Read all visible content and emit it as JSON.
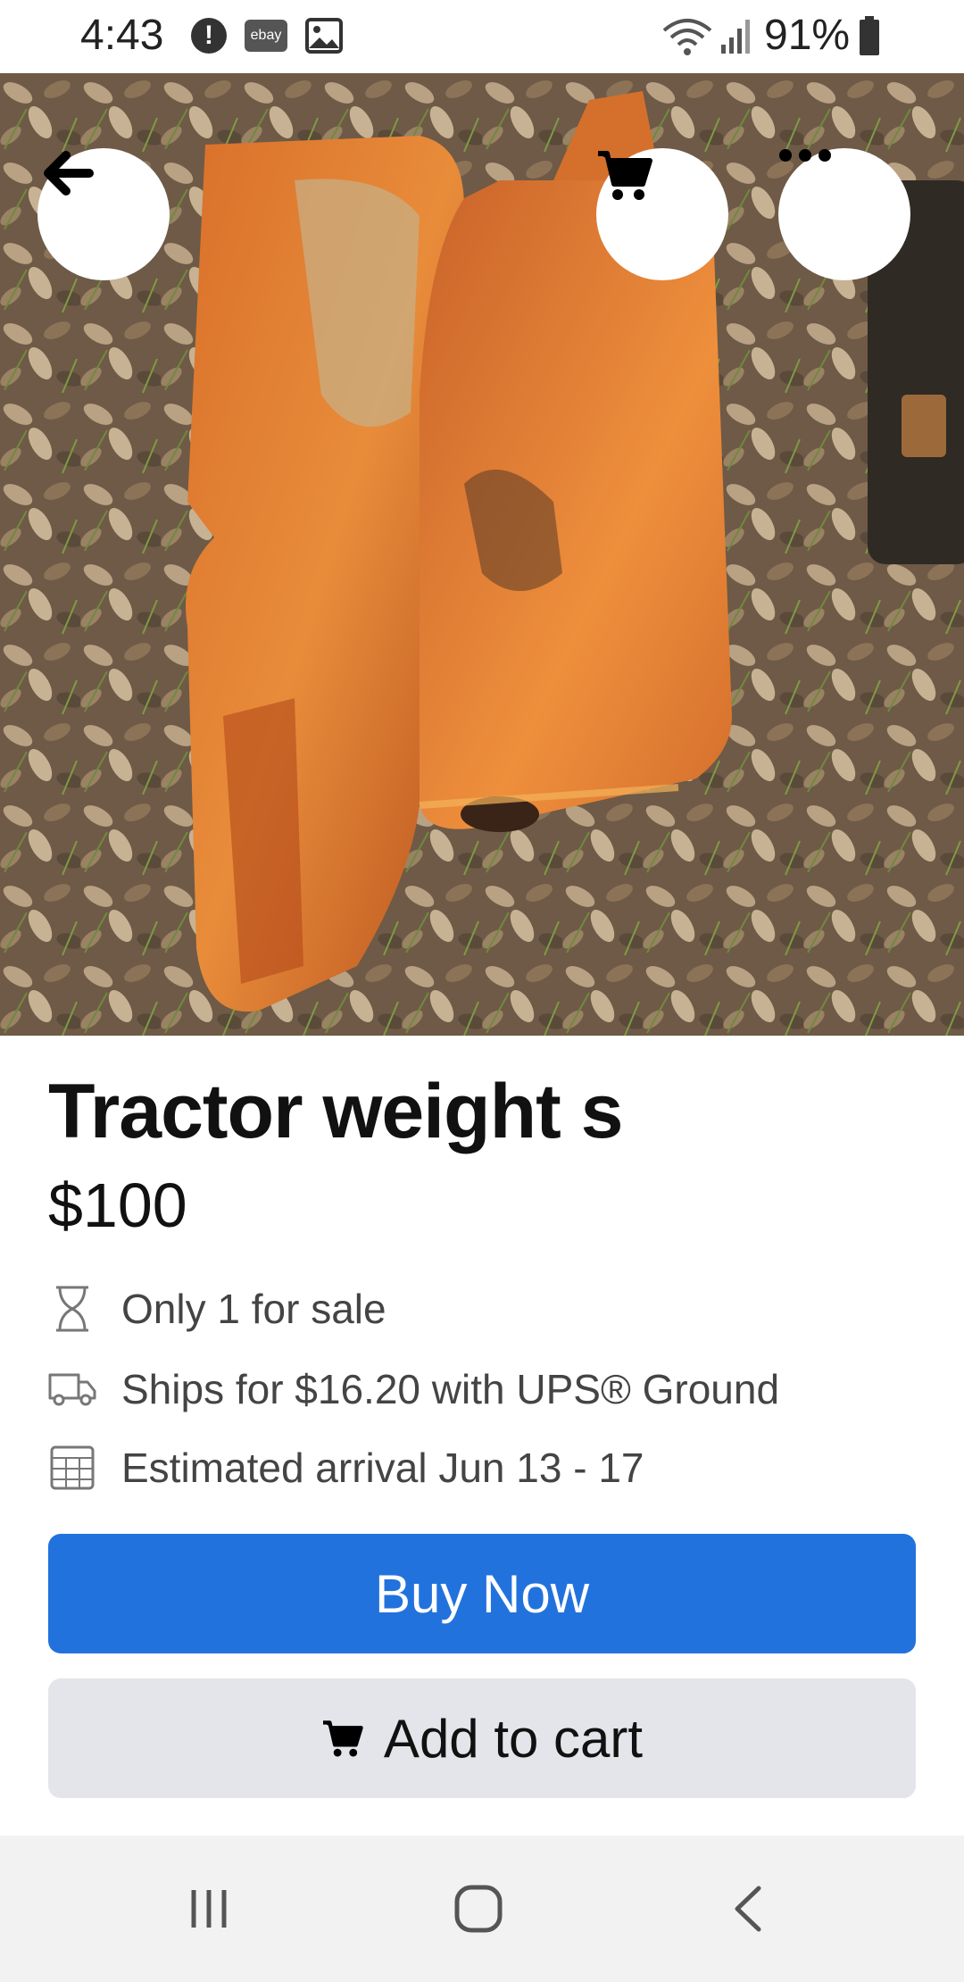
{
  "status_bar": {
    "time": "4:43",
    "ebay_label": "ebay",
    "battery": "91%"
  },
  "hero": {
    "image_description_icon": "product-photo",
    "slide_count": 3,
    "active_slide": 1
  },
  "product": {
    "title": "Tractor weight s",
    "price": "$100",
    "availability": "Only 1 for sale",
    "shipping": "Ships for $16.20 with UPS® Ground",
    "arrival": "Estimated arrival Jun 13 - 17"
  },
  "actions": {
    "buy_now": "Buy Now",
    "add_to_cart": "Add to cart"
  },
  "colors": {
    "primary": "#2272dd",
    "secondary_bg": "#e4e5ea"
  }
}
